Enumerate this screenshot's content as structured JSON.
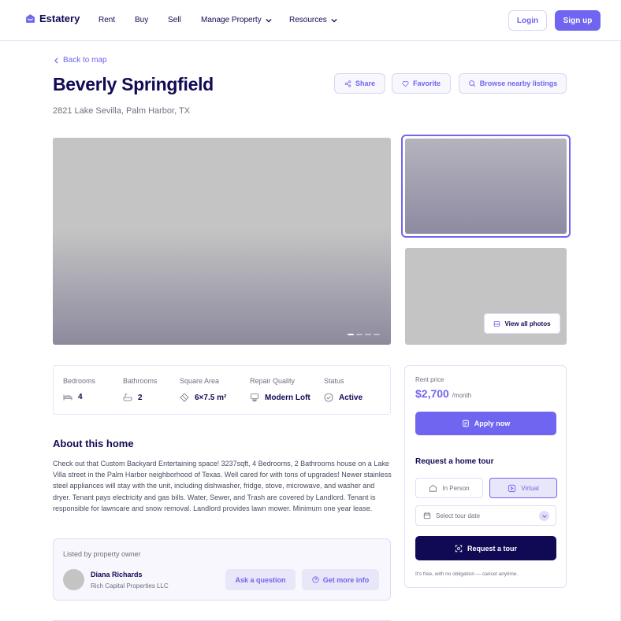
{
  "nav": {
    "brand": "Estatery",
    "links": [
      "Rent",
      "Buy",
      "Sell",
      "Manage Property",
      "Resources"
    ],
    "login": "Login",
    "signup": "Sign up"
  },
  "listing": {
    "back": "Back to map",
    "title": "Beverly Springfield",
    "address": "2821 Lake Sevilla, Palm Harbor, TX",
    "actions": {
      "share": "Share",
      "favorite": "Favorite",
      "browse": "Browse nearby listings"
    },
    "view_all_photos": "View all photos"
  },
  "stats": [
    {
      "label": "Bedrooms",
      "value": "4",
      "icon": "bed-icon"
    },
    {
      "label": "Bathrooms",
      "value": "2",
      "icon": "bath-icon"
    },
    {
      "label": "Square Area",
      "value": "6×7.5 m²",
      "icon": "area-icon"
    },
    {
      "label": "Repair Quality",
      "value": "Modern Loft",
      "icon": "quality-icon"
    },
    {
      "label": "Status",
      "value": "Active",
      "icon": "check-circle-icon"
    }
  ],
  "about": {
    "title": "About this home",
    "text": "Check out that Custom Backyard Entertaining space! 3237sqft, 4 Bedrooms, 2 Bathrooms house on a Lake Villa  street in the Palm Harbor neighborhood of Texas. Well cared for with tons of upgrades! Newer stainless steel appliances will stay with the unit, including dishwasher, fridge, stove, microwave, and washer and dryer. Tenant pays electricity and gas bills. Water, Sewer, and Trash are covered by Landlord. Tenant is responsible for lawncare and snow removal. Landlord provides lawn mower. Minimum one year lease."
  },
  "owner": {
    "label": "Listed by property owner",
    "name": "Diana Richards",
    "company": "Rich Capital Properties LLC",
    "ask": "Ask a question",
    "info": "Get more info"
  },
  "rent": {
    "label": "Rent price",
    "price": "$2,700",
    "unit": "/month",
    "apply": "Apply now",
    "tour_title": "Request a home tour",
    "in_person": "In Person",
    "virtual": "Virtual",
    "date_placeholder": "Select tour date",
    "request": "Request a tour",
    "note": "It's free, with no obligation — cancel anytime."
  },
  "colors": {
    "accent": "#7065f0",
    "dark": "#100a55",
    "muted": "#6c727f",
    "border": "#e0def7"
  }
}
